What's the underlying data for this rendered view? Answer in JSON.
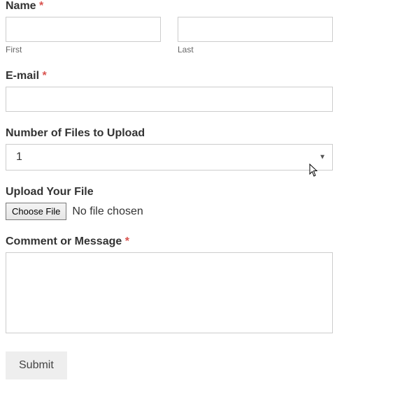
{
  "name": {
    "label": "Name",
    "required_mark": "*",
    "first_sublabel": "First",
    "last_sublabel": "Last",
    "first_value": "",
    "last_value": ""
  },
  "email": {
    "label": "E-mail",
    "required_mark": "*",
    "value": ""
  },
  "numfiles": {
    "label": "Number of Files to Upload",
    "selected": "1"
  },
  "upload": {
    "label": "Upload Your File",
    "button": "Choose File",
    "status": "No file chosen"
  },
  "comment": {
    "label": "Comment or Message",
    "required_mark": "*",
    "value": ""
  },
  "submit": {
    "label": "Submit"
  }
}
